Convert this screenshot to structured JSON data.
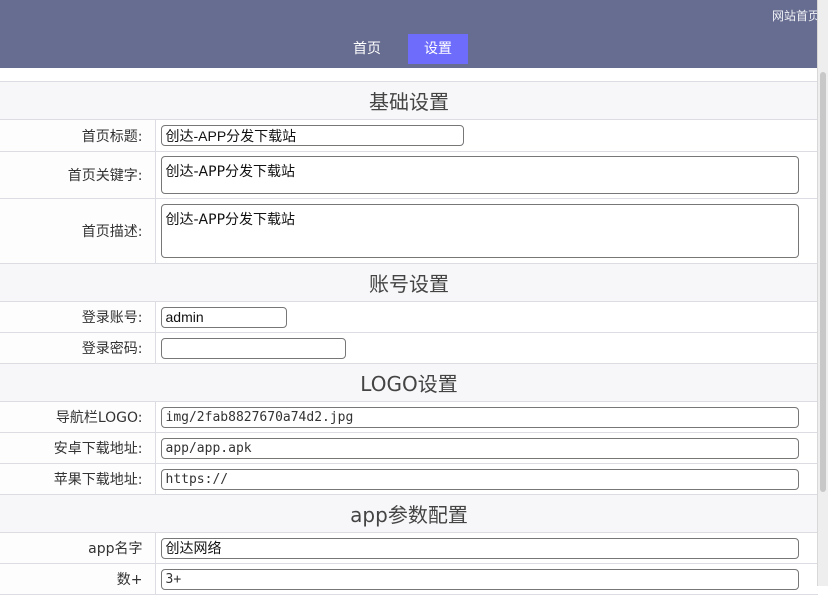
{
  "header": {
    "top_link": "网站首页",
    "nav": [
      {
        "label": "首页",
        "active": false
      },
      {
        "label": "设置",
        "active": true
      }
    ]
  },
  "sections": {
    "basic": "基础设置",
    "account": "账号设置",
    "logo": "LOGO设置",
    "app": "app参数配置"
  },
  "fields": {
    "home_title": {
      "label": "首页标题:",
      "value": "创达-APP分发下载站"
    },
    "home_keywords": {
      "label": "首页关键字:",
      "value": "创达-APP分发下载站"
    },
    "home_description": {
      "label": "首页描述:",
      "value": "创达-APP分发下载站"
    },
    "login_account": {
      "label": "登录账号:",
      "value": "admin"
    },
    "login_password": {
      "label": "登录密码:",
      "value": ""
    },
    "nav_logo": {
      "label": "导航栏LOGO:",
      "value": "img/2fab8827670a74d2.jpg"
    },
    "android_url": {
      "label": "安卓下载地址:",
      "value": "app/app.apk"
    },
    "apple_url": {
      "label": "苹果下载地址:",
      "value": "https://"
    },
    "app_name": {
      "label": "app名字",
      "value": "创达网络"
    },
    "app_count": {
      "label": "数+",
      "value": "3+"
    }
  }
}
